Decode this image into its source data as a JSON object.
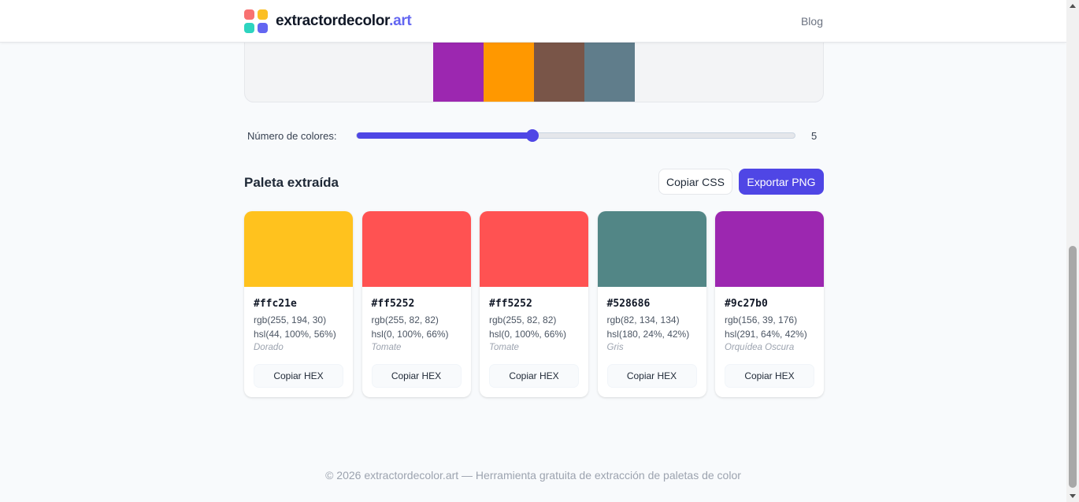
{
  "header": {
    "brand_main": "extractordecolor",
    "brand_tld": ".art",
    "logo_colors": [
      "#f87171",
      "#fbbf24",
      "#2dd4bf",
      "#6366f1"
    ],
    "nav_blog": "Blog"
  },
  "preview": {
    "strip_colors": [
      "#9c27b0",
      "#ff9800",
      "#795548",
      "#607d8b"
    ]
  },
  "slider": {
    "label": "Número de colores:",
    "value": "5",
    "fill_fraction": 0.4
  },
  "palette": {
    "title": "Paleta extraída",
    "copy_css_label": "Copiar CSS",
    "export_png_label": "Exportar PNG",
    "colors": [
      {
        "hex": "#ffc21e",
        "swatch": "#ffc21e",
        "rgb": "rgb(255, 194, 30)",
        "hsl": "hsl(44, 100%, 56%)",
        "name": "Dorado",
        "button": "Copiar HEX"
      },
      {
        "hex": "#ff5252",
        "swatch": "#ff5252",
        "rgb": "rgb(255, 82, 82)",
        "hsl": "hsl(0, 100%, 66%)",
        "name": "Tomate",
        "button": "Copiar HEX"
      },
      {
        "hex": "#ff5252",
        "swatch": "#ff5252",
        "rgb": "rgb(255, 82, 82)",
        "hsl": "hsl(0, 100%, 66%)",
        "name": "Tomate",
        "button": "Copiar HEX"
      },
      {
        "hex": "#528686",
        "swatch": "#528686",
        "rgb": "rgb(82, 134, 134)",
        "hsl": "hsl(180, 24%, 42%)",
        "name": "Gris",
        "button": "Copiar HEX"
      },
      {
        "hex": "#9c27b0",
        "swatch": "#9c27b0",
        "rgb": "rgb(156, 39, 176)",
        "hsl": "hsl(291, 64%, 42%)",
        "name": "Orquídea Oscura",
        "button": "Copiar HEX"
      }
    ]
  },
  "footer": {
    "text": "© 2026 extractordecolor.art — Herramienta gratuita de extracción de paletas de color"
  },
  "theme": {
    "accent": "#4f46e5"
  }
}
